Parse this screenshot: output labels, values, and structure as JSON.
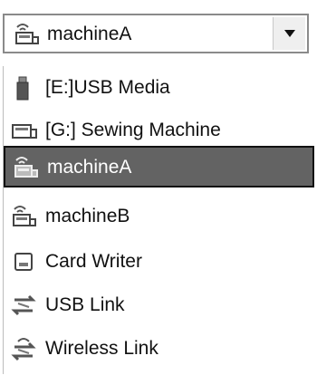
{
  "combo": {
    "selected_label": "machineA",
    "selected_icon": "wireless-machine-icon",
    "arrow_icon": "chevron-down-icon"
  },
  "list": {
    "items": [
      {
        "label": "[E:]USB Media",
        "icon": "usb-stick-icon",
        "selected": false
      },
      {
        "label": "[G:] Sewing Machine",
        "icon": "sewing-machine-icon",
        "selected": false
      },
      {
        "label": "machineA",
        "icon": "wireless-machine-icon",
        "selected": true
      },
      {
        "label": "machineB",
        "icon": "wireless-machine-icon",
        "selected": false
      },
      {
        "label": "Card Writer",
        "icon": "card-writer-icon",
        "selected": false
      },
      {
        "label": "USB Link",
        "icon": "usb-link-icon",
        "selected": false
      },
      {
        "label": "Wireless Link",
        "icon": "wireless-link-icon",
        "selected": false
      }
    ]
  },
  "colors": {
    "selection_bg": "#636363",
    "selection_border": "#111111"
  }
}
